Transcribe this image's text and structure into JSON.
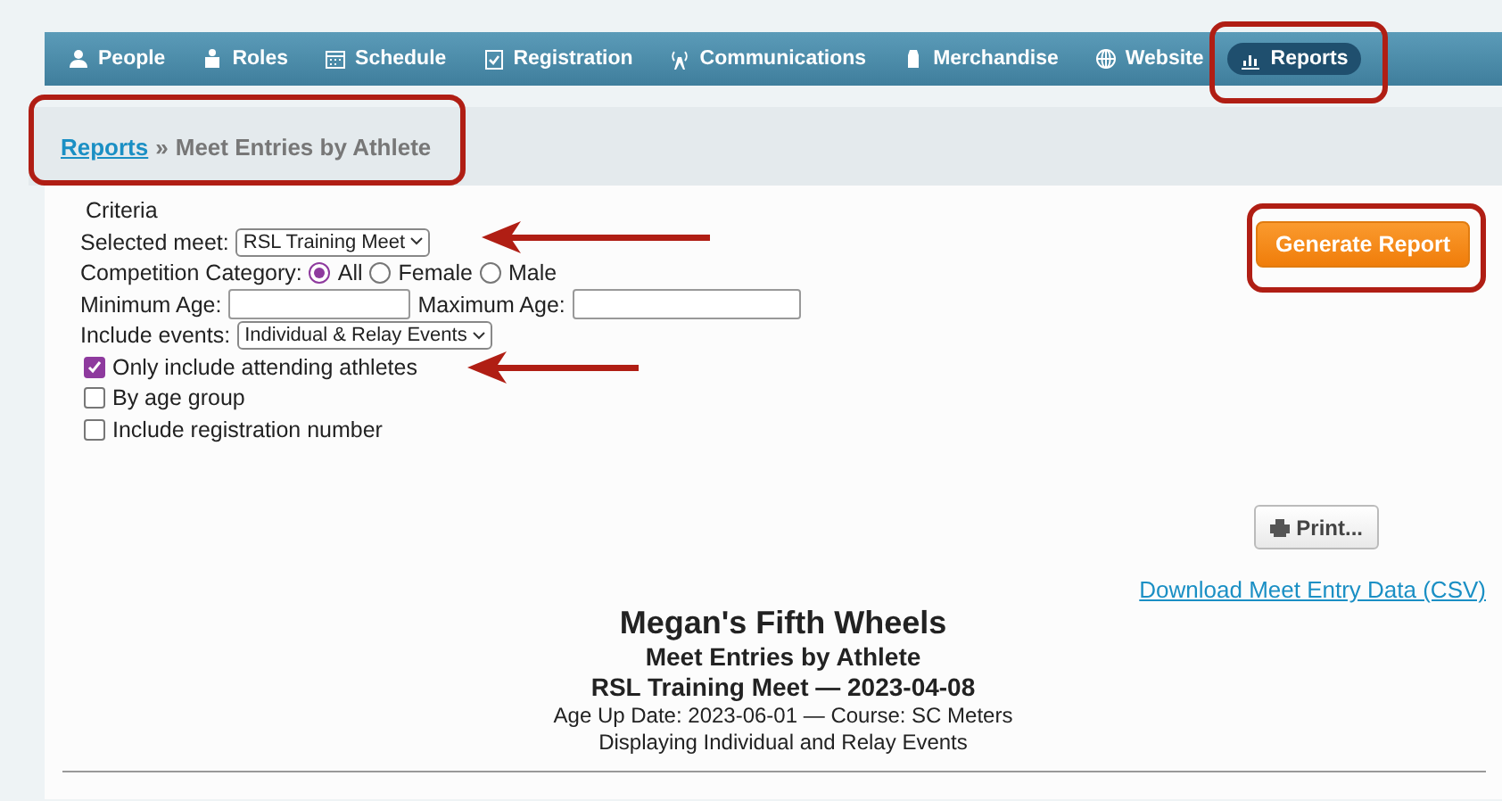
{
  "nav": [
    {
      "label": "People",
      "selected": false
    },
    {
      "label": "Roles",
      "selected": false
    },
    {
      "label": "Schedule",
      "selected": false
    },
    {
      "label": "Registration",
      "selected": false
    },
    {
      "label": "Communications",
      "selected": false
    },
    {
      "label": "Merchandise",
      "selected": false
    },
    {
      "label": "Website",
      "selected": false
    },
    {
      "label": "Reports",
      "selected": true
    }
  ],
  "breadcrumb": {
    "link": "Reports",
    "separator": "»",
    "current": "Meet Entries by Athlete"
  },
  "criteria": {
    "title": "Criteria",
    "meet": {
      "label": "Selected meet:",
      "value": "RSL Training Meet"
    },
    "category": {
      "label": "Competition Category:",
      "options": [
        {
          "label": "All",
          "selected": true
        },
        {
          "label": "Female",
          "selected": false
        },
        {
          "label": "Male",
          "selected": false
        }
      ]
    },
    "min_age": {
      "label": "Minimum Age:"
    },
    "max_age": {
      "label": "Maximum Age:"
    },
    "events": {
      "label": "Include events:",
      "value": "Individual & Relay Events"
    },
    "checkboxes": [
      {
        "label": "Only include attending athletes",
        "checked": true
      },
      {
        "label": "By age group",
        "checked": false
      },
      {
        "label": "Include registration number",
        "checked": false
      }
    ]
  },
  "generate_button": "Generate Report",
  "print_button": "Print...",
  "csv_link": "Download Meet Entry Data (CSV)",
  "report": {
    "team": "Megan's Fifth Wheels",
    "title": "Meet Entries by Athlete",
    "meet": "RSL Training Meet — 2023-04-08",
    "details": "Age Up Date: 2023-06-01 — Course: SC Meters",
    "display": "Displaying Individual and Relay Events"
  }
}
